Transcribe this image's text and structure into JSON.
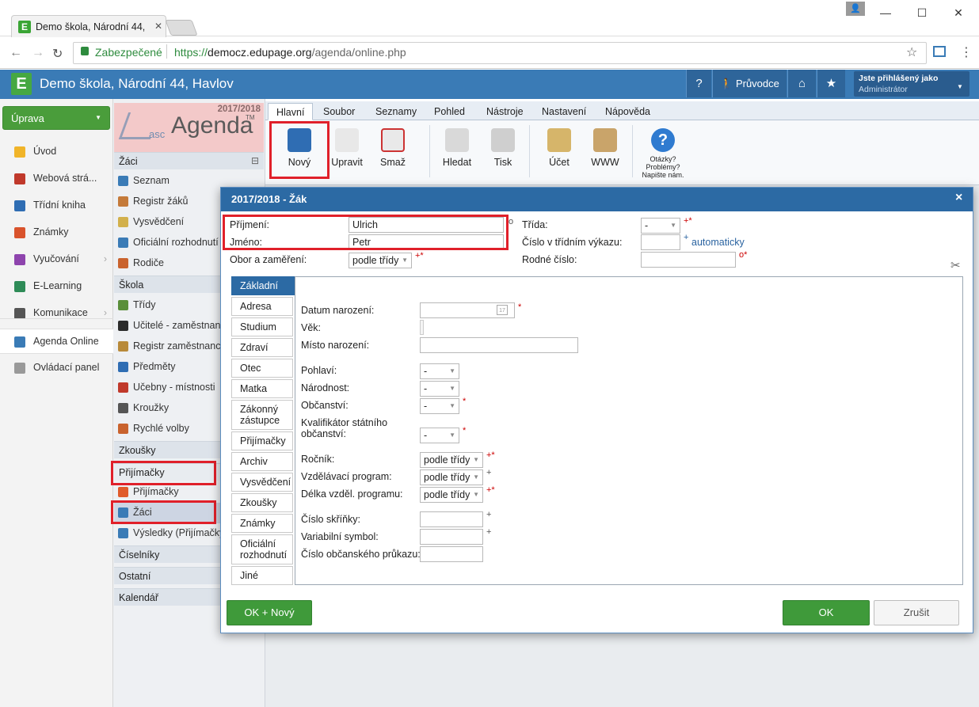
{
  "browser": {
    "tab_title": "Demo škola, Národní 44,",
    "secure_label": "Zabezpečené",
    "url_prefix": "https://",
    "url_host": "democz.edupage.org",
    "url_path": "/agenda/online.php"
  },
  "app": {
    "title": "Demo škola, Národní 44, Havlov",
    "help_label": "?",
    "guide_label": "Průvodce",
    "user_caption": "Jste přihlášený jako",
    "user_role": "Administrátor"
  },
  "left_sidebar": {
    "uprava_label": "Úprava",
    "items": [
      {
        "label": "Úvod",
        "color": "#f0b429"
      },
      {
        "label": "Webová strá...",
        "color": "#c0392b"
      },
      {
        "label": "Třídní kniha",
        "color": "#2f6db3"
      },
      {
        "label": "Známky",
        "color": "#d9532c"
      },
      {
        "label": "Vyučování",
        "color": "#8e44ad"
      },
      {
        "label": "E-Learning",
        "color": "#2e8b57"
      },
      {
        "label": "Komunikace",
        "color": "#555555"
      },
      {
        "label": "Agenda Online",
        "color": "#3a7bb6"
      },
      {
        "label": "Ovládací panel",
        "color": "#999999"
      }
    ]
  },
  "agenda": {
    "year": "2017/2018",
    "brand_prefix": "asc",
    "brand": "Agenda",
    "tm": "TM"
  },
  "middle_menu": {
    "sections": [
      {
        "title": "Žáci",
        "collapse": "⊟"
      },
      {
        "title": "Škola"
      },
      {
        "title": "Zkoušky"
      },
      {
        "title": "Přijímačky"
      },
      {
        "title": "Číselníky"
      },
      {
        "title": "Ostatní"
      },
      {
        "title": "Kalendář"
      }
    ],
    "zaci_items": [
      "Seznam",
      "Registr žáků",
      "Vysvědčení",
      "Oficiální rozhodnutí",
      "Rodiče"
    ],
    "skola_items": [
      "Třídy",
      "Učitelé - zaměstnanci",
      "Registr zaměstnanců",
      "Předměty",
      "Učebny - místnosti",
      "Kroužky",
      "Rychlé volby"
    ],
    "prijimacky_items": [
      "Přijímačky",
      "Žáci",
      "Výsledky (Přijímačky)"
    ]
  },
  "ribbon": {
    "tabs": [
      "Hlavní",
      "Soubor",
      "Seznamy",
      "Pohled",
      "Nástroje",
      "Nastavení",
      "Nápověda"
    ],
    "buttons": [
      "Nový",
      "Upravit",
      "Smaž",
      "Hledat",
      "Tisk",
      "Účet",
      "WWW"
    ],
    "help_lines": [
      "Otázky?",
      "Problémy?",
      "Napište nám."
    ]
  },
  "dialog": {
    "title": "2017/2018 - Žák",
    "close": "×",
    "fields": {
      "prijmeni_label": "Příjmení:",
      "prijmeni_value": "Ulrich",
      "jmeno_label": "Jméno:",
      "jmeno_value": "Petr",
      "obor_label": "Obor a zaměření:",
      "obor_value": "podle třídy",
      "trida_label": "Třída:",
      "trida_value": "-",
      "cislo_vykaz_label": "Číslo v třídním výkazu:",
      "automaticky": "automaticky",
      "rodne_cislo_label": "Rodné číslo:"
    },
    "side_tabs": [
      "Základní",
      "Adresa",
      "Studium",
      "Zdraví",
      "Otec",
      "Matka",
      "Zákonný zástupce",
      "Přijímačky",
      "Archiv",
      "Vysvědčení",
      "Zkoušky",
      "Známky",
      "Oficiální rozhodnutí",
      "Jiné"
    ],
    "basic": {
      "datum_narozeni": "Datum narození:",
      "vek": "Věk:",
      "misto_narozeni": "Místo narození:",
      "pohlavi": "Pohlaví:",
      "narodnost": "Národnost:",
      "obcanstvi": "Občanství:",
      "kvalifikator": "Kvalifikátor státního",
      "kvalifikator2": "občanství:",
      "rocnik": "Ročník:",
      "program": "Vzdělávací program:",
      "delka": "Délka vzděl. programu:",
      "skrinka": "Číslo skříňky:",
      "var_symbol": "Variabilní symbol:",
      "op": "Číslo občanského průkazu:",
      "dash": "-",
      "podle_tridy": "podle třídy"
    },
    "buttons": {
      "ok_novy": "OK + Nový",
      "ok": "OK",
      "zrusit": "Zrušit"
    }
  },
  "marks": {
    "req_plus_star": "+*",
    "req_star": "*",
    "req_plus": "+",
    "req_circle_star": "o*",
    "req_circle": "o"
  }
}
